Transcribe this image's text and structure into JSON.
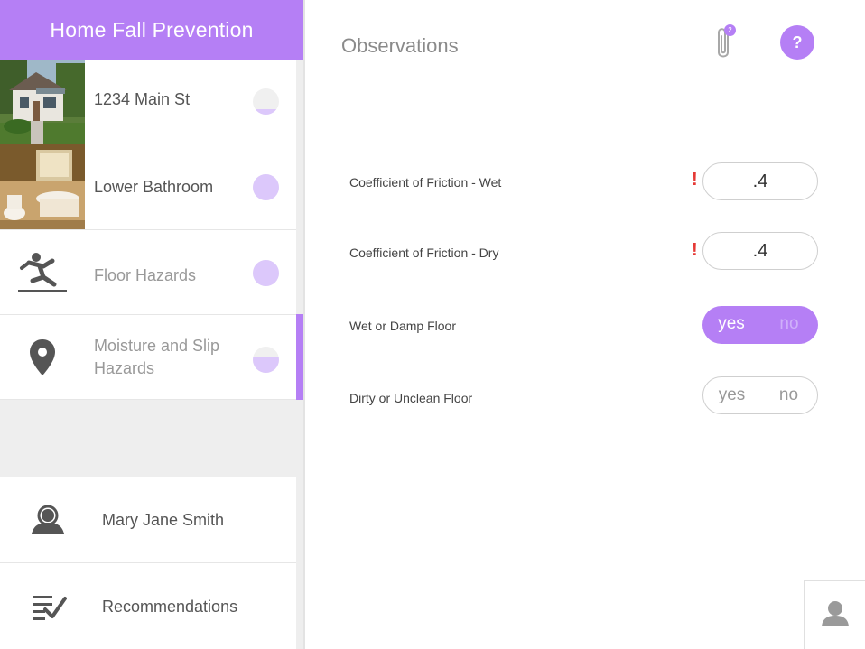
{
  "sidebar": {
    "title": "Home Fall Prevention",
    "items": [
      {
        "label": "1234 Main St",
        "thumb": "house-photo",
        "progress": 0.2
      },
      {
        "label": "Lower Bathroom",
        "thumb": "bathroom-photo",
        "progress": 1.0
      },
      {
        "label": "Floor Hazards",
        "icon": "slip-fall-icon",
        "progress": 1.0
      },
      {
        "label": "Moisture and Slip Hazards",
        "icon": "location-pin-icon",
        "progress": 0.6,
        "active": true
      }
    ],
    "bottom": [
      {
        "label": "Mary Jane Smith",
        "icon": "person-icon"
      },
      {
        "label": "Recommendations",
        "icon": "checklist-icon"
      }
    ]
  },
  "main": {
    "title": "Observations",
    "attachment_count": "2",
    "help_label": "?",
    "fields": [
      {
        "label": "Coefficient of Friction - Wet",
        "value": ".4",
        "warning": "!"
      },
      {
        "label": "Coefficient of Friction - Dry",
        "value": ".4",
        "warning": "!"
      },
      {
        "label": "Wet or Damp Floor",
        "yes": "yes",
        "no": "no",
        "selected": "yes"
      },
      {
        "label": "Dirty or Unclean Floor",
        "yes": "yes",
        "no": "no",
        "selected": null
      }
    ]
  },
  "colors": {
    "accent": "#b57ff5",
    "progress_fill": "#dcc8fb",
    "warning": "#e53935"
  }
}
